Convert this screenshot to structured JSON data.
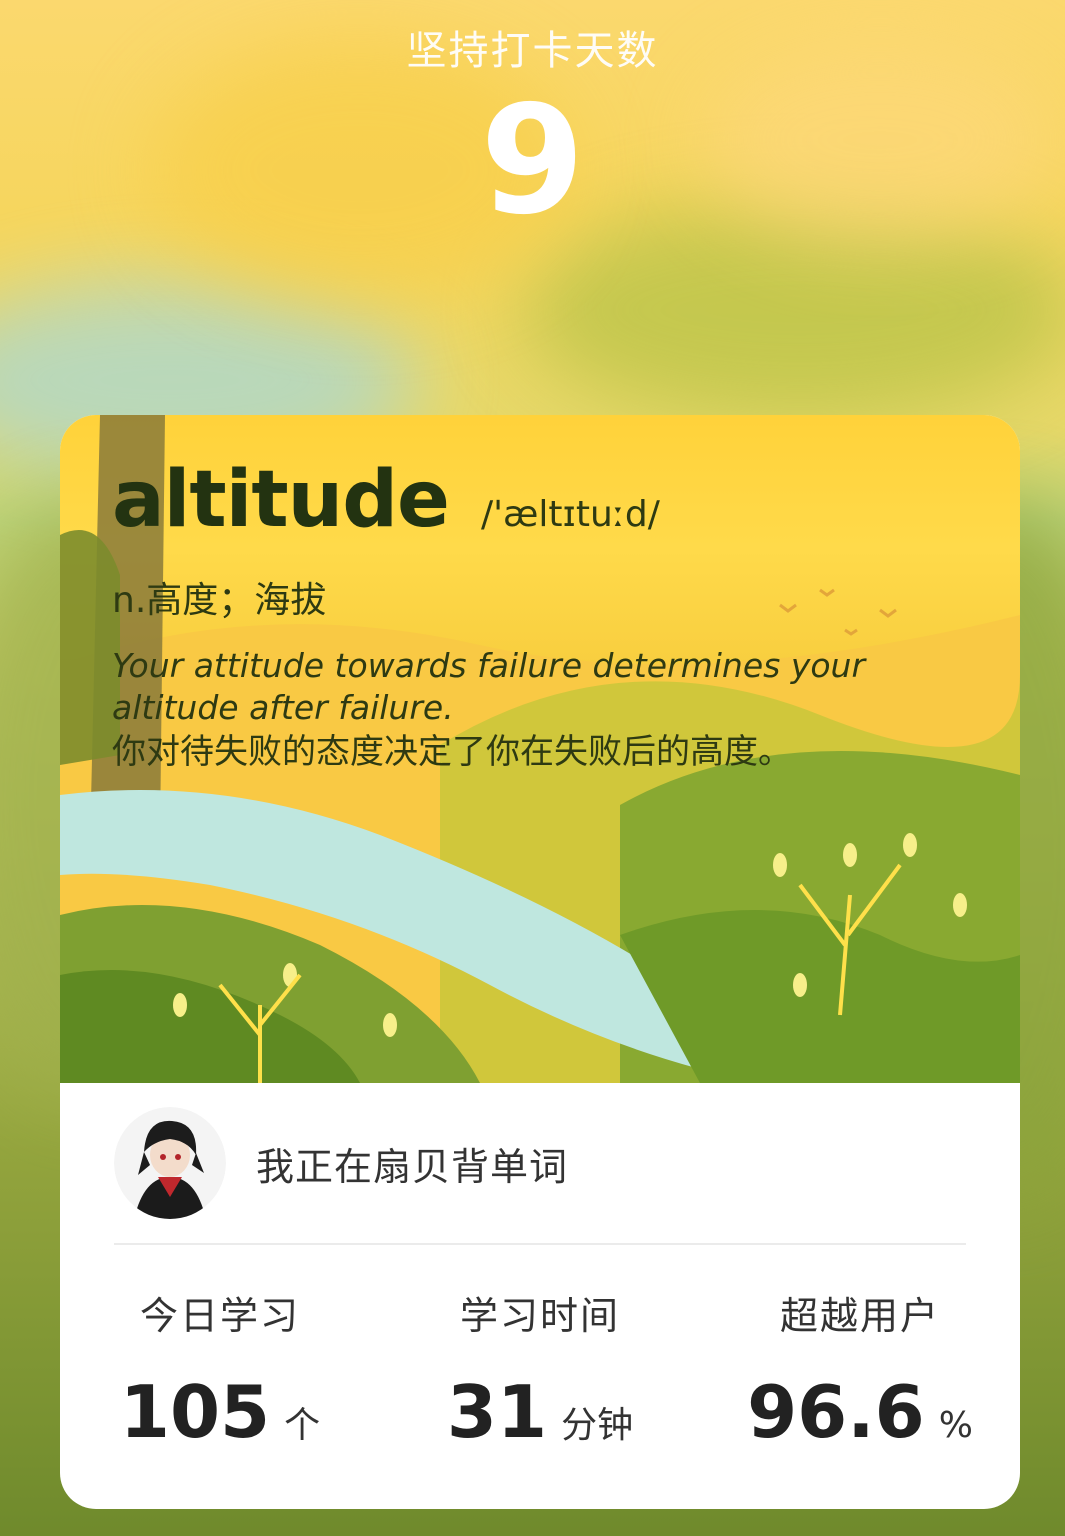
{
  "header": {
    "title": "坚持打卡天数",
    "days": "9"
  },
  "word_card": {
    "word": "altitude",
    "phonetic": "/'æltɪtuːd/",
    "meaning": "n.高度；海拔",
    "example_en": "Your attitude towards failure determines your altitude after failure.",
    "example_zh": "你对待失败的态度决定了你在失败后的高度。"
  },
  "user": {
    "status": "我正在扇贝背单词",
    "avatar_icon": "user-avatar-anime-icon"
  },
  "stats": [
    {
      "label": "今日学习",
      "value": "105",
      "unit": "个"
    },
    {
      "label": "学习时间",
      "value": "31",
      "unit": "分钟"
    },
    {
      "label": "超越用户",
      "value": "96.6",
      "unit": "%"
    }
  ],
  "colors": {
    "card_bg": "#ffffff",
    "text_dark": "#233311",
    "header_text": "#ffffff"
  }
}
